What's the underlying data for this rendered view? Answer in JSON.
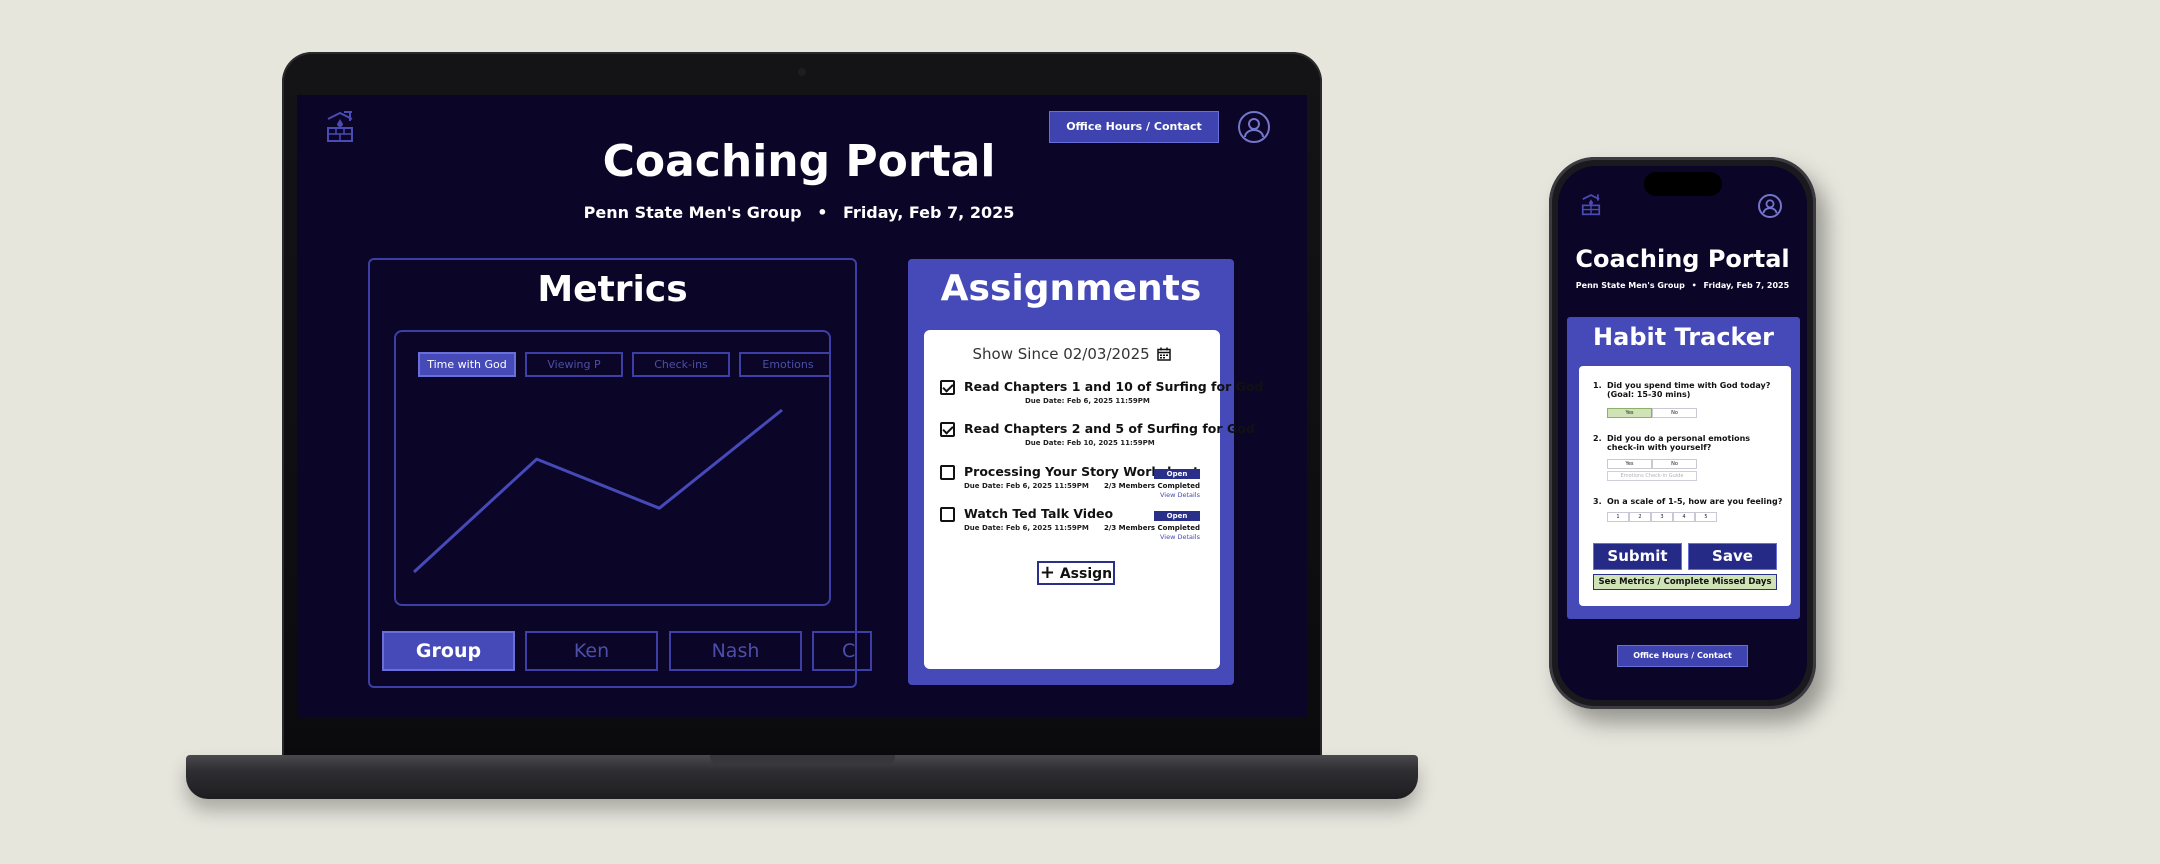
{
  "laptop": {
    "office_hours_label": "Office Hours / Contact",
    "title": "Coaching Portal",
    "subtitle_group": "Penn State Men's Group",
    "subtitle_dot": "•",
    "subtitle_date": "Friday, Feb 7, 2025",
    "metrics": {
      "title": "Metrics",
      "filters": [
        "Time with God",
        "Viewing P",
        "Check-ins",
        "Emotions"
      ],
      "active_filter": "Time with God",
      "people_tabs": [
        "Group",
        "Ken",
        "Nash",
        "C"
      ],
      "active_person": "Group",
      "chart_data": {
        "type": "line",
        "series_color": "#4649b8",
        "values": [
          0,
          2.3,
          1.3,
          3.3
        ],
        "xlabel": "",
        "ylabel": "",
        "grid": false,
        "legend": "none"
      }
    },
    "assignments": {
      "title": "Assignments",
      "show_since": "Show Since 02/03/2025",
      "tasks": [
        {
          "title": "Read Chapters 1 and 10 of Surfing for God",
          "due": "Due Date: Feb 6, 2025 11:59PM",
          "checked": true
        },
        {
          "title": "Read Chapters 2 and 5 of Surfing for God",
          "due": "Due Date: Feb 10, 2025 11:59PM",
          "checked": true
        },
        {
          "title": "Processing Your Story Worksheet",
          "due": "Due Date: Feb 6, 2025 11:59PM",
          "checked": false,
          "open": "Open",
          "members": "2/3 Members Completed",
          "details": "View Details"
        },
        {
          "title": "Watch Ted Talk Video",
          "due": "Due Date: Feb 6, 2025 11:59PM",
          "checked": false,
          "open": "Open",
          "members": "2/3 Members Completed",
          "details": "View Details"
        }
      ],
      "assign_label": "Assign",
      "assign_plus": "+"
    }
  },
  "phone": {
    "title": "Coaching Portal",
    "subtitle_group": "Penn State Men's Group",
    "subtitle_dot": "•",
    "subtitle_date": "Friday, Feb 7, 2025",
    "habit_tracker": {
      "title": "Habit Tracker",
      "q1_num": "1.",
      "q1": "Did you spend time with God today? (Goal: 15-30 mins)",
      "q2_num": "2.",
      "q2": "Did you do a personal emotions check-in with yourself?",
      "q3_num": "3.",
      "q3": "On a scale of 1-5, how are you feeling?",
      "yes": "Yes",
      "no": "No",
      "emotions_placeholder": "Emotions Check-in Guide",
      "scale": [
        "1",
        "2",
        "3",
        "4",
        "5"
      ],
      "submit_label": "Submit",
      "save_label": "Save",
      "see_metrics_label": "See Metrics / Complete Missed Days"
    },
    "office_hours_label": "Office Hours / Contact"
  },
  "colors": {
    "background": "#e6e6dd",
    "screen": "#0b0527",
    "accent": "#4649b8",
    "selected_option": "#cfe3b6"
  }
}
